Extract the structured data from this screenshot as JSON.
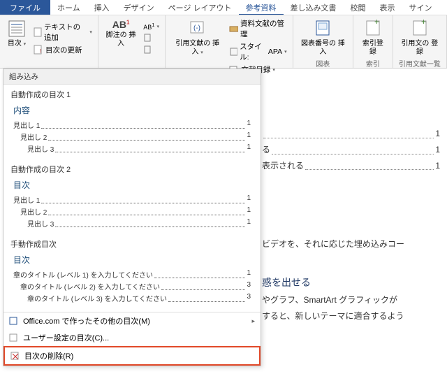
{
  "tabs": {
    "file": "ファイル",
    "home": "ホーム",
    "insert": "挿入",
    "design": "デザイン",
    "layout": "ページ レイアウト",
    "references": "参考資料",
    "mailings": "差し込み文書",
    "review": "校閲",
    "view": "表示",
    "signin": "サイン"
  },
  "ribbon": {
    "toc": {
      "button": "目次",
      "addText": "テキストの追加",
      "update": "目次の更新"
    },
    "footnote": {
      "button": "脚注の\n挿入",
      "ab": "AB"
    },
    "citation": {
      "button": "引用文献の\n挿入",
      "manage": "資料文献の管理",
      "styleLabel": "スタイル:",
      "styleValue": "APA",
      "biblio": "文献目録"
    },
    "captions": {
      "button": "図表番号の\n挿入",
      "group": "図表"
    },
    "index": {
      "button": "索引登録",
      "group": "索引"
    },
    "toa": {
      "button": "引用文の\n登録",
      "group": "引用文献一覧"
    }
  },
  "dropdown": {
    "builtin": "組み込み",
    "auto1": "自動作成の目次 1",
    "auto2": "自動作成の目次 2",
    "manual": "手動作成目次",
    "h_contents": "内容",
    "h_toc": "目次",
    "h1": "見出し 1",
    "h2": "見出し 2",
    "h3": "見出し 3",
    "chapL1": "章のタイトル (レベル 1) を入力してください",
    "chapL2": "章のタイトル (レベル 2) を入力してください",
    "chapL3": "章のタイトル (レベル 3) を入力してください",
    "pg1": "1",
    "pg3": "3",
    "office": "Office.com で作ったその他の目次(M)",
    "custom": "ユーザー設定の目次(C)...",
    "remove": "目次の削除(R)"
  },
  "doc": {
    "l1": "る",
    "l2": "表示される",
    "p1": "ビデオを、それに応じた埋め込みコー",
    "h1": "惑を出せる",
    "p2": "やグラフ、SmartArt グラフィックが",
    "p3": "すると、新しいテーマに適合するよう"
  }
}
